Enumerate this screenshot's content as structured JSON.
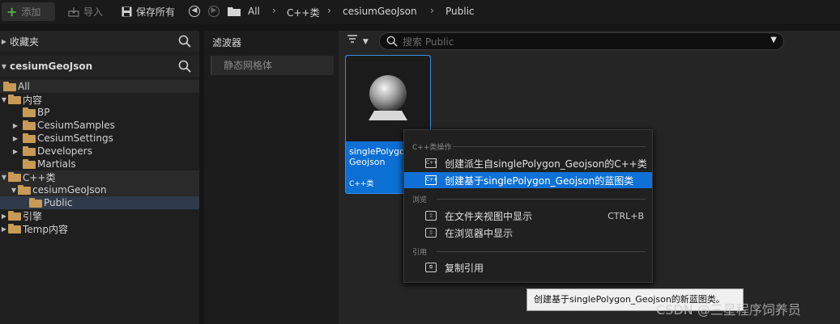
{
  "toolbar": {
    "add_label": "添加",
    "import_label": "导入",
    "save_all_label": "保存所有",
    "breadcrumb": [
      "All",
      "C++类",
      "cesiumGeoJson",
      "Public"
    ]
  },
  "favorites": {
    "title": "收藏夹"
  },
  "project": {
    "title": "cesiumGeoJson"
  },
  "tree": {
    "items": [
      {
        "label": "All"
      },
      {
        "label": "内容"
      },
      {
        "label": "BP"
      },
      {
        "label": "CesiumSamples"
      },
      {
        "label": "CesiumSettings"
      },
      {
        "label": "Developers"
      },
      {
        "label": "Martials"
      },
      {
        "label": "C++类"
      },
      {
        "label": "cesiumGeoJson"
      },
      {
        "label": "Public"
      },
      {
        "label": "引擎"
      },
      {
        "label": "Temp内容"
      }
    ]
  },
  "filters": {
    "title": "滤波器",
    "chip": "静态网格体"
  },
  "search": {
    "placeholder": "搜索 Public"
  },
  "asset": {
    "name_line1": "singlePolygon_",
    "name_line2": "Geojson",
    "type": "C++类"
  },
  "context_menu": {
    "section_cpp": "C++类操作",
    "create_derived": "创建派生自singlePolygon_Geojson的C++类",
    "create_blueprint": "创建基于singlePolygon_Geojson的蓝图类",
    "section_browse": "浏览",
    "show_in_folder": "在文件夹视图中显示",
    "show_in_folder_shortcut": "CTRL+B",
    "show_in_browser": "在浏览器中显示",
    "section_reference": "引用",
    "copy_reference": "复制引用"
  },
  "tooltip": "创建基于singlePolygon_Geojson的新蓝图类。",
  "watermark": "CSDN @三星程序饲养员",
  "colors": {
    "accent": "#0f70d7",
    "folder": "#c89a55",
    "add_plus": "#57b046"
  }
}
